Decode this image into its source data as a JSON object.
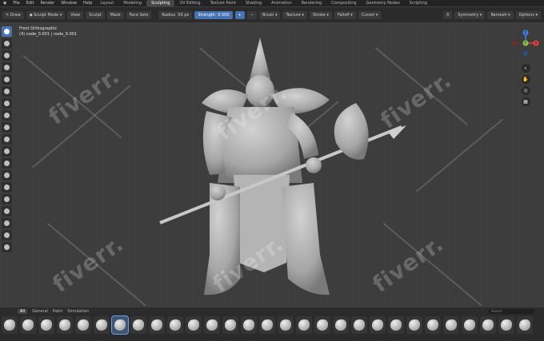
{
  "menu": {
    "items": [
      "File",
      "Edit",
      "Render",
      "Window",
      "Help"
    ]
  },
  "workspaces": {
    "items": [
      "Layout",
      "Modeling",
      "Sculpting",
      "UV Editing",
      "Texture Paint",
      "Shading",
      "Animation",
      "Rendering",
      "Compositing",
      "Geometry Nodes",
      "Scripting"
    ],
    "active_index": 2
  },
  "header": {
    "brush_name": "Draw",
    "mode": "Sculpt Mode",
    "view": "View",
    "sculpt": "Sculpt",
    "mask": "Mask",
    "face_sets": "Face Sets",
    "radius_label": "Radius",
    "radius_value": "50 px",
    "strength_label": "Strength",
    "strength_value": "0.500",
    "brush": "Brush",
    "texture": "Texture",
    "stroke": "Stroke",
    "falloff": "Falloff",
    "cursor": "Cursor",
    "symmetry": "Symmetry",
    "remesh": "Remesh",
    "options": "Options"
  },
  "viewport": {
    "view_name": "Front Orthographic",
    "object_info": "(4) node_0.001 | node_0.001",
    "watermark": "fiverr."
  },
  "gizmo": {
    "x": "X",
    "y": "Y",
    "z": "Z",
    "x_color": "#e0443d",
    "y_color": "#8bc34a",
    "z_color": "#3f7fe0"
  },
  "left_tools": [
    "draw-icon",
    "smooth-icon",
    "pinch-icon",
    "clay-icon",
    "inflate-icon",
    "grab-icon",
    "snake-hook-icon",
    "thumb-icon",
    "mask-icon",
    "face-set-icon",
    "cloth-icon",
    "elastic-icon",
    "rotate-icon",
    "scale-icon",
    "transform-icon",
    "annotate-icon"
  ],
  "bottom": {
    "tabs": [
      "All",
      "General",
      "Paint",
      "Simulation"
    ],
    "active_tab": 0,
    "search_placeholder": "Search",
    "brush_count": 29,
    "selected_brush_index": 6
  },
  "accent": "#4772b3"
}
